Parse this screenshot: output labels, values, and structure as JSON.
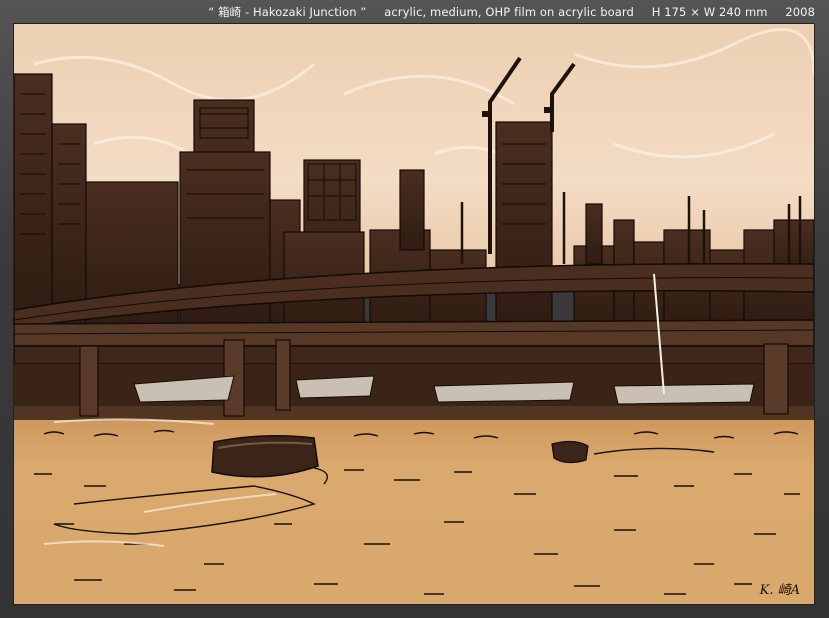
{
  "caption": {
    "title": "“ 箱崎 - Hakozaki Junction ”",
    "medium": "acrylic, medium, OHP film on acrylic board",
    "size": "H 175 × W 240 mm",
    "year": "2008"
  },
  "painting": {
    "signature": "K. 崎A",
    "colors": {
      "sky": "#f0d3b6",
      "sky_light": "#f8e9d8",
      "water": "#d9a86c",
      "water_dark": "#c18a4f",
      "silhouette": "#3b2418",
      "ink": "#140b06"
    }
  }
}
